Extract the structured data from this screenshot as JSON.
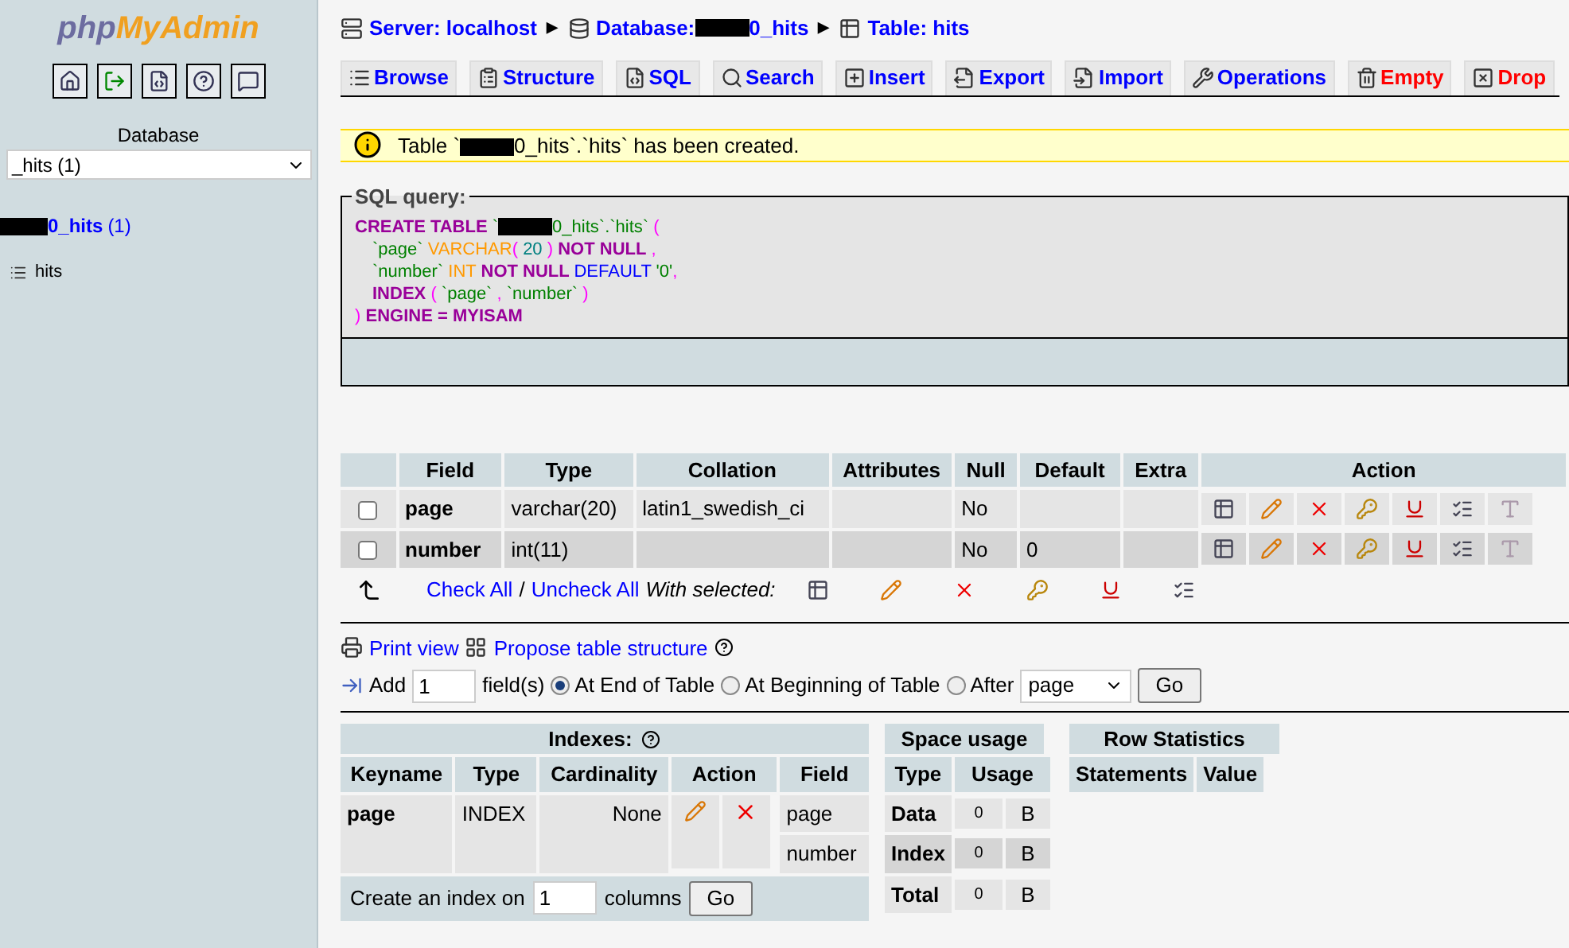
{
  "sidebar": {
    "logo_php": "php",
    "logo_rest": "MyAdmin",
    "db_label": "Database",
    "db_select": "_hits (1)",
    "db_link": "0_hits",
    "db_count": "(1)",
    "tables": [
      "hits"
    ]
  },
  "breadcrumb": [
    {
      "label": "Server: localhost",
      "redacted": false,
      "separator": "▶"
    },
    {
      "label": "Database:",
      "redacted": true,
      "suffix": "0_hits",
      "separator": "▶"
    },
    {
      "label": "Table: hits",
      "redacted": false
    }
  ],
  "tabs": [
    {
      "label": "Browse",
      "kind": "normal"
    },
    {
      "label": "Structure",
      "kind": "normal"
    },
    {
      "label": "SQL",
      "kind": "normal"
    },
    {
      "label": "Search",
      "kind": "normal"
    },
    {
      "label": "Insert",
      "kind": "normal"
    },
    {
      "label": "Export",
      "kind": "normal"
    },
    {
      "label": "Import",
      "kind": "normal"
    },
    {
      "label": "Operations",
      "kind": "normal"
    },
    {
      "label": "Empty",
      "kind": "danger"
    },
    {
      "label": "Drop",
      "kind": "danger"
    }
  ],
  "notice": {
    "prefix": "Table `",
    "suffix": "0_hits`.`hits` has been created."
  },
  "sql": {
    "legend": "SQL query:",
    "lines": [
      [
        {
          "t": "CREATE TABLE",
          "kind": "keyword"
        },
        {
          "t": " `",
          "kind": "ident"
        },
        {
          "kind": "redacted"
        },
        {
          "t": "0_hits`.`hits`",
          "kind": "ident"
        },
        {
          "t": " (",
          "kind": "punct"
        }
      ],
      [
        {
          "t": "`page`",
          "kind": "ident"
        },
        {
          "t": " VARCHAR",
          "kind": "type"
        },
        {
          "t": "( ",
          "kind": "punct"
        },
        {
          "t": "20",
          "kind": "number"
        },
        {
          "t": " ) ",
          "kind": "punct"
        },
        {
          "t": "NOT NULL",
          "kind": "keyword"
        },
        {
          "t": " ,",
          "kind": "punct"
        }
      ],
      [
        {
          "t": "`number`",
          "kind": "ident"
        },
        {
          "t": " INT ",
          "kind": "type"
        },
        {
          "t": "NOT NULL ",
          "kind": "keyword"
        },
        {
          "t": "DEFAULT ",
          "kind": "default"
        },
        {
          "t": "'0'",
          "kind": "ident"
        },
        {
          "t": ",",
          "kind": "punct"
        }
      ],
      [
        {
          "t": "INDEX ",
          "kind": "keyword"
        },
        {
          "t": "( ",
          "kind": "punct"
        },
        {
          "t": "`page`",
          "kind": "ident"
        },
        {
          "t": " , ",
          "kind": "punct"
        },
        {
          "t": "`number`",
          "kind": "ident"
        },
        {
          "t": " )",
          "kind": "punct"
        }
      ],
      [
        {
          "t": ") ",
          "kind": "punct"
        },
        {
          "t": "ENGINE = MYISAM",
          "kind": "keyword"
        }
      ]
    ]
  },
  "structure": {
    "headers": [
      "Field",
      "Type",
      "Collation",
      "Attributes",
      "Null",
      "Default",
      "Extra",
      "Action"
    ],
    "rows": [
      {
        "checked": false,
        "field": "page",
        "type": "varchar(20)",
        "collation": "latin1_swedish_ci",
        "null": "No"
      },
      {
        "checked": false,
        "field": "number",
        "type": "int(11)",
        "null": "No",
        "default": "0"
      }
    ]
  },
  "selection": {
    "check_all": "Check All",
    "separator": "/",
    "uncheck_all": "Uncheck All",
    "with_selected": "With selected:"
  },
  "links": {
    "print_view": "Print view",
    "propose": "Propose table structure"
  },
  "add_field": {
    "label": "Add",
    "value": "1",
    "unit": "field(s)",
    "positions": [
      {
        "label": "At End of Table",
        "selected": true
      },
      {
        "label": "At Beginning of Table",
        "selected": false
      },
      {
        "label": "After",
        "selected": false
      }
    ],
    "after_value": "page",
    "go": "Go"
  },
  "indexes": {
    "title": "Indexes:",
    "headers": [
      "Keyname",
      "Type",
      "Cardinality",
      "Action",
      "Field"
    ],
    "rows": [
      {
        "keyname": "page",
        "type": "INDEX",
        "cardinality": "None",
        "fields": [
          "page",
          "number"
        ]
      }
    ],
    "create": {
      "prefix": "Create an index on",
      "value": "1",
      "suffix": "columns",
      "go": "Go"
    }
  },
  "space_usage": {
    "title": "Space usage",
    "headers": [
      "Type",
      "Usage"
    ],
    "rows": [
      {
        "type": "Data",
        "value": "0",
        "unit": "B",
        "highlighted": false
      },
      {
        "type": "Index",
        "value": "0",
        "unit": "B",
        "highlighted": true
      },
      {
        "type": "Total",
        "value": "0",
        "unit": "B",
        "highlighted": false
      }
    ]
  },
  "row_statistics": {
    "title": "Row Statistics",
    "headers": [
      "Statements",
      "Value"
    ]
  }
}
